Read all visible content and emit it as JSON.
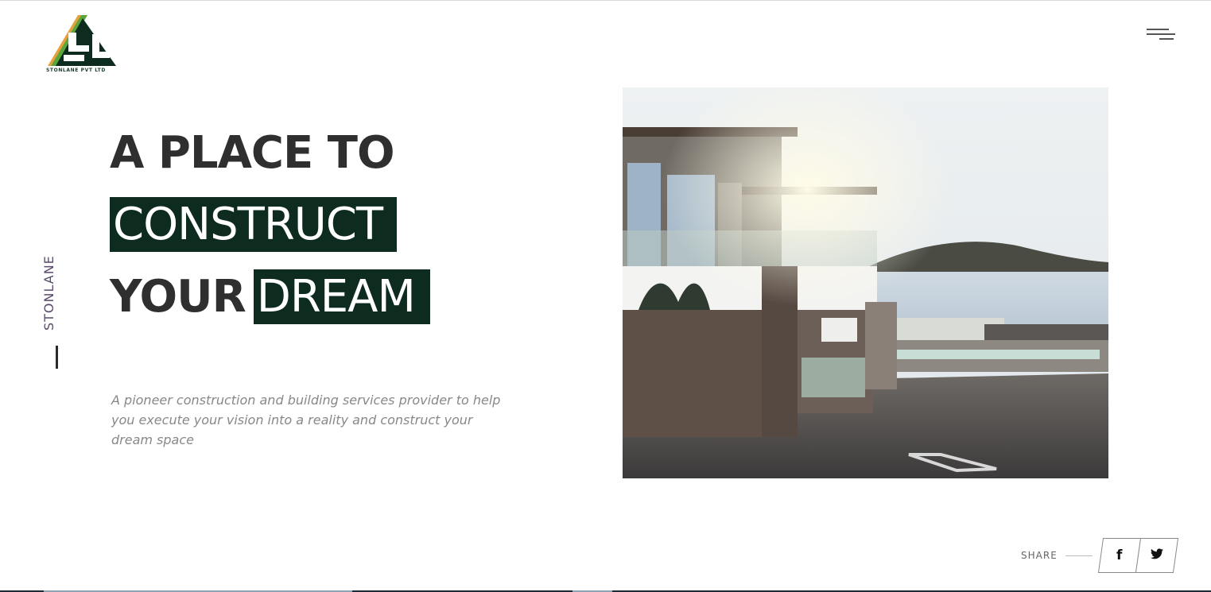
{
  "brand": {
    "logo_text": "STONLANE PVT LTD",
    "vertical_name": "STONLANE",
    "colors": {
      "primary": "#0e2b20",
      "accent_orange": "#e8a03c",
      "accent_green": "#5aa63a"
    }
  },
  "header": {
    "menu_icon": "hamburger-menu-icon"
  },
  "hero": {
    "line1": "A PLACE TO",
    "line2_highlight": "CONSTRUCT",
    "line3_plain": "YOUR",
    "line3_highlight": "DREAM",
    "description": "A pioneer construction and building services provider to help you execute your vision into a reality and construct your dream space"
  },
  "share": {
    "label": "SHARE",
    "facebook_glyph": "f",
    "twitter_glyph": "🐦",
    "facebook_icon": "facebook-icon",
    "twitter_icon": "twitter-icon"
  }
}
